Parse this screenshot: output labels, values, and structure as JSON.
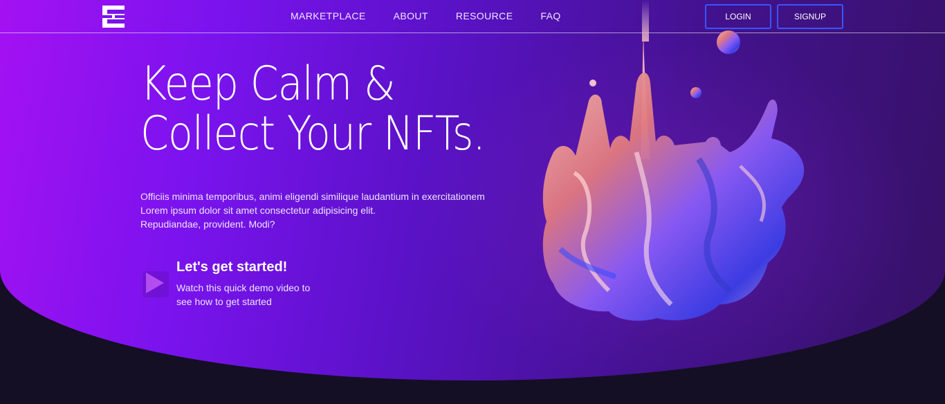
{
  "nav": {
    "logo_icon": "brand-logo-icon",
    "links": [
      "MARKETPLACE",
      "ABOUT",
      "RESOURCE",
      "FAQ"
    ],
    "login_label": "LOGIN",
    "signup_label": "SIGNUP"
  },
  "hero": {
    "headline_line1": "Keep Calm &",
    "headline_line2": "Collect Your NFTs.",
    "paragraph_lines": [
      "Officiis minima temporibus, animi eligendi similique laudantium in exercitationem",
      "Lorem ipsum dolor sit amet consectetur adipisicing elit.",
      "Repudiandae, provident. Modi?"
    ],
    "cta_title": "Let's get started!",
    "cta_desc_lines": [
      "Watch this quick demo video to",
      "see how to get started"
    ],
    "play_icon": "play-icon",
    "artwork_icon": "liquid-splash-artwork"
  },
  "colors": {
    "accent_border": "#3a55ff",
    "gradient_start": "#a411f2",
    "gradient_end": "#361166",
    "page_bg": "#140f24"
  }
}
